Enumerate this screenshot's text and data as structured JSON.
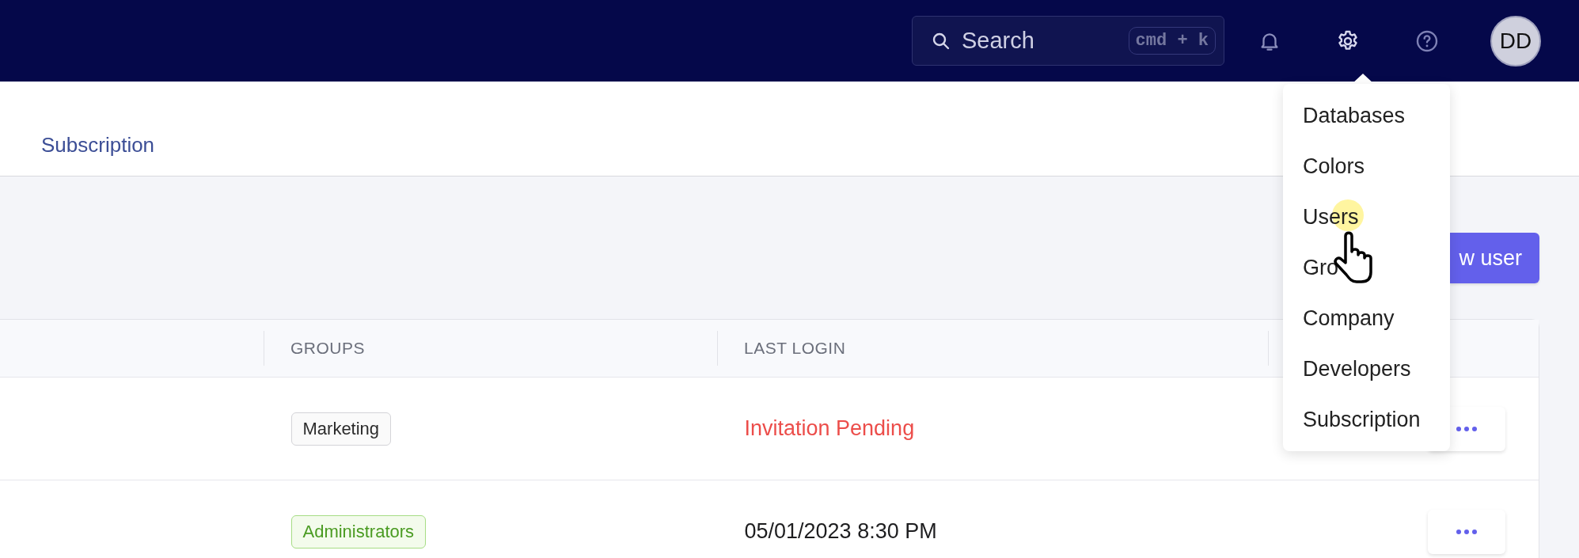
{
  "top_bar": {
    "search": {
      "placeholder": "Search",
      "shortcut": "cmd + k"
    },
    "avatar": "DD"
  },
  "tabs": [
    {
      "label": "Subscription",
      "selected": false
    }
  ],
  "new_user_button": "w user",
  "table": {
    "columns": [
      {
        "label": "GROUPS"
      },
      {
        "label": "LAST LOGIN"
      }
    ],
    "rows": [
      {
        "group": {
          "label": "Marketing",
          "color": "#2b2b2b"
        },
        "last_login": {
          "text": "Invitation Pending",
          "kind": "pending"
        }
      },
      {
        "group": {
          "label": "Administrators",
          "color": "#4a9b22"
        },
        "last_login": {
          "text": "05/01/2023 8:30 PM",
          "kind": "date"
        }
      }
    ]
  },
  "settings_menu": {
    "items": [
      {
        "label": "Databases"
      },
      {
        "label": "Colors"
      },
      {
        "label": "Users"
      },
      {
        "label": "Gro"
      },
      {
        "label": "Company"
      },
      {
        "label": "Developers"
      },
      {
        "label": "Subscription"
      }
    ]
  }
}
